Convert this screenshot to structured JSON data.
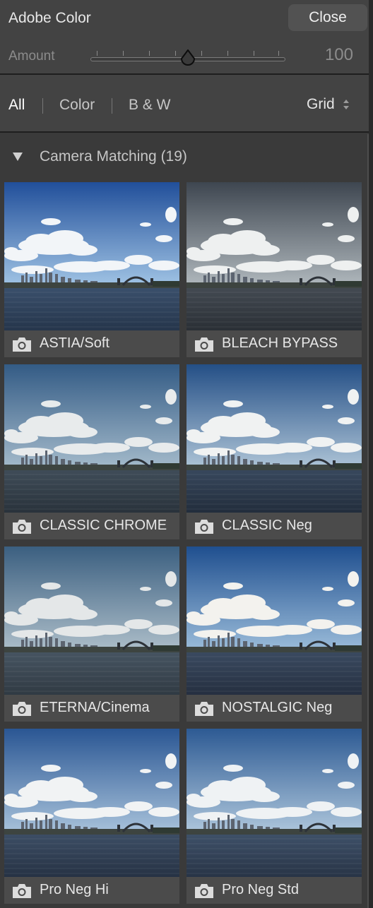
{
  "panel": {
    "title": "Adobe Color",
    "close_label": "Close",
    "amount_label": "Amount",
    "amount_value": "100",
    "amount_fraction": 0.5
  },
  "filters": {
    "all": "All",
    "color": "Color",
    "bw": "B & W",
    "active": "All",
    "view_label": "Grid"
  },
  "group": {
    "title": "Camera Matching (19)",
    "expanded": true
  },
  "profiles": [
    {
      "label": "ASTIA/Soft",
      "tint": "astia"
    },
    {
      "label": "BLEACH BYPASS",
      "tint": "bleach"
    },
    {
      "label": "CLASSIC CHROME",
      "tint": "chrome"
    },
    {
      "label": "CLASSIC Neg",
      "tint": "neg"
    },
    {
      "label": "ETERNA/Cinema",
      "tint": "eterna"
    },
    {
      "label": "NOSTALGIC Neg",
      "tint": "nostalgic"
    },
    {
      "label": "Pro Neg Hi",
      "tint": "proneghi"
    },
    {
      "label": "Pro Neg Std",
      "tint": "pronegstd"
    }
  ],
  "icons": {
    "profile": "camera-icon",
    "group_toggle": "triangle-down-icon",
    "view_dropdown": "up-down-chevron-icon"
  },
  "colors": {
    "panel_bg": "#434343",
    "body_bg": "#3a3a3a",
    "caption_bg": "#4b4b4b",
    "text": "#dcdcdc"
  }
}
